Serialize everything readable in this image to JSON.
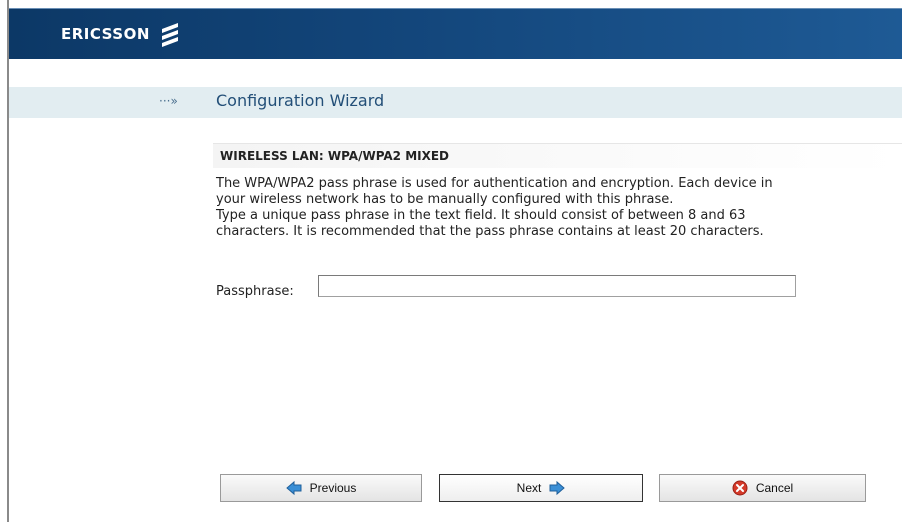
{
  "header": {
    "brand": "ERICSSON"
  },
  "wizard": {
    "arrow": "···»",
    "title": "Configuration Wizard"
  },
  "section": {
    "heading": "WIRELESS LAN: WPA/WPA2 MIXED",
    "description_lines": [
      "The WPA/WPA2 pass phrase is used for authentication and encryption. Each device in",
      "your wireless network has to be manually configured with this phrase.",
      "Type a unique pass phrase in the text field. It should consist of between 8 and 63",
      "characters. It is recommended that the pass phrase contains at least 20 characters."
    ]
  },
  "form": {
    "passphrase_label": "Passphrase:",
    "passphrase_value": ""
  },
  "buttons": {
    "previous": "Previous",
    "next": "Next",
    "cancel": "Cancel"
  },
  "icons": {
    "previous": "left-arrow-icon",
    "next": "right-arrow-icon",
    "cancel": "cancel-icon"
  },
  "colors": {
    "header": "#13467b",
    "title_band": "#e2edf1",
    "title_text": "#234f78",
    "arrow_icon": "#3a8fd6",
    "cancel_icon": "#d43a2a"
  }
}
